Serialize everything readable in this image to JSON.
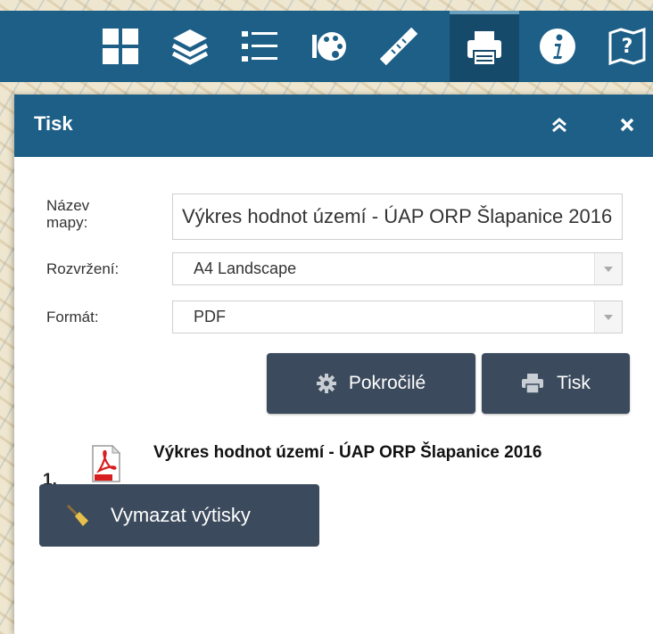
{
  "toolbar": {
    "buttons": [
      {
        "name": "overview",
        "icon": "grid-icon"
      },
      {
        "name": "layers",
        "icon": "layers-icon"
      },
      {
        "name": "legend",
        "icon": "list-icon"
      },
      {
        "name": "basemap",
        "icon": "palette-icon"
      },
      {
        "name": "measure",
        "icon": "ruler-icon"
      },
      {
        "name": "print",
        "icon": "printer-icon",
        "active": true
      },
      {
        "name": "info",
        "icon": "info-icon"
      },
      {
        "name": "help",
        "icon": "help-map-icon"
      }
    ]
  },
  "panel": {
    "title": "Tisk",
    "collapse_icon": "double-chevron-up-icon",
    "close_icon": "close-icon"
  },
  "form": {
    "map_name_label_line1": "Název",
    "map_name_label_line2": "mapy:",
    "map_name_value": "Výkres hodnot území - ÚAP ORP Šlapanice 2016",
    "layout_label": "Rozvržení:",
    "layout_value": "A4 Landscape",
    "format_label": "Formát:",
    "format_value": "PDF"
  },
  "buttons": {
    "advanced_label": "Pokročilé",
    "print_label": "Tisk",
    "clear_label": "Vymazat výtisky"
  },
  "results": [
    {
      "number": "1.",
      "title": "Výkres hodnot území - ÚAP ORP Šlapanice 2016"
    }
  ],
  "colors": {
    "header": "#1d5f86",
    "button": "#3b4a5c"
  }
}
